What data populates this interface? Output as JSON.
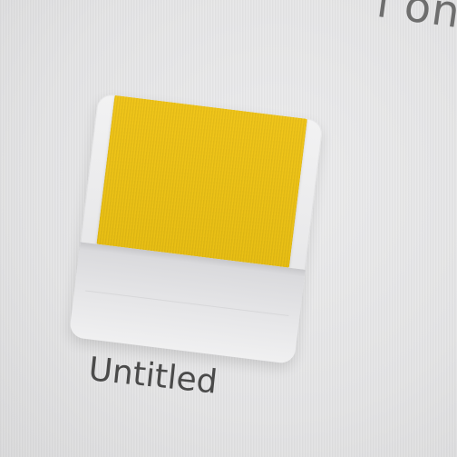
{
  "screen": {
    "top_text": "l on th",
    "document": {
      "label": "Untitled",
      "icon": "document-tile-icon",
      "accent_color": "#f1c61a"
    }
  }
}
